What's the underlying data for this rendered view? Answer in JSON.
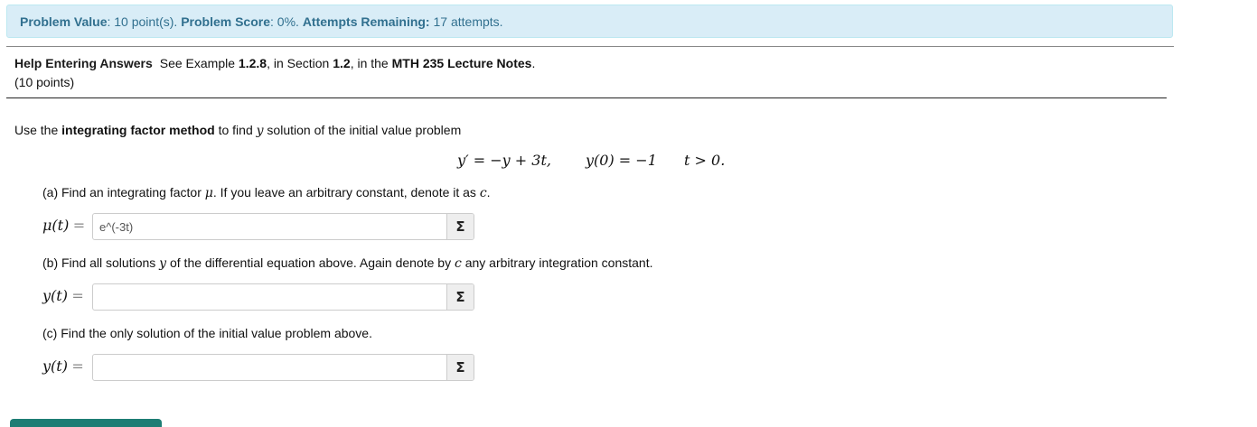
{
  "status_bar": {
    "value_label": "Problem Value",
    "value_text": ": 10 point(s). ",
    "score_label": "Problem Score",
    "score_text": ": 0%. ",
    "attempts_label": "Attempts Remaining:",
    "attempts_text": " 17 attempts."
  },
  "help": {
    "link_label": "Help Entering Answers",
    "see_text": "See Example ",
    "example_number": "1.2.8",
    "in_section_text": ", in Section ",
    "section_number": "1.2",
    "in_the_text": ", in the ",
    "notes_title": "MTH 235 Lecture Notes",
    "period": "."
  },
  "points_text": "(10 points)",
  "problem": {
    "intro_prefix": "Use the ",
    "method": "integrating factor method",
    "intro_mid": " to find ",
    "var_y": "y",
    "intro_suffix": " solution of the initial value problem",
    "ode": "y′ = −y + 3t,",
    "initial_condition": "y(0) = −1",
    "domain": "t > 0."
  },
  "parts": [
    {
      "label_prefix": "(a) Find an integrating factor ",
      "label_symbol": "μ",
      "label_suffix": ". If you leave an arbitrary constant, denote it as ",
      "label_const": "c",
      "label_end": ".",
      "lhs": "μ(t)",
      "equals": "=",
      "value": "e^(-3t)",
      "button_icon": "sigma-icon",
      "button_glyph": "Σ"
    },
    {
      "label_prefix": "(b) Find all solutions ",
      "label_symbol": "y",
      "label_suffix": " of the differential equation above. Again denote by ",
      "label_const": "c",
      "label_end": " any arbitrary integration constant.",
      "lhs": "y(t)",
      "equals": "=",
      "value": "",
      "button_icon": "sigma-icon",
      "button_glyph": "Σ"
    },
    {
      "label_prefix": "(c) Find the only solution of the initial value problem above.",
      "label_symbol": "",
      "label_suffix": "",
      "label_const": "",
      "label_end": "",
      "lhs": "y(t)",
      "equals": "=",
      "value": "",
      "button_icon": "sigma-icon",
      "button_glyph": "Σ"
    }
  ],
  "colors": {
    "info_bg": "#d9edf7",
    "info_text": "#31708f",
    "submit_button": "#1d7d74"
  }
}
